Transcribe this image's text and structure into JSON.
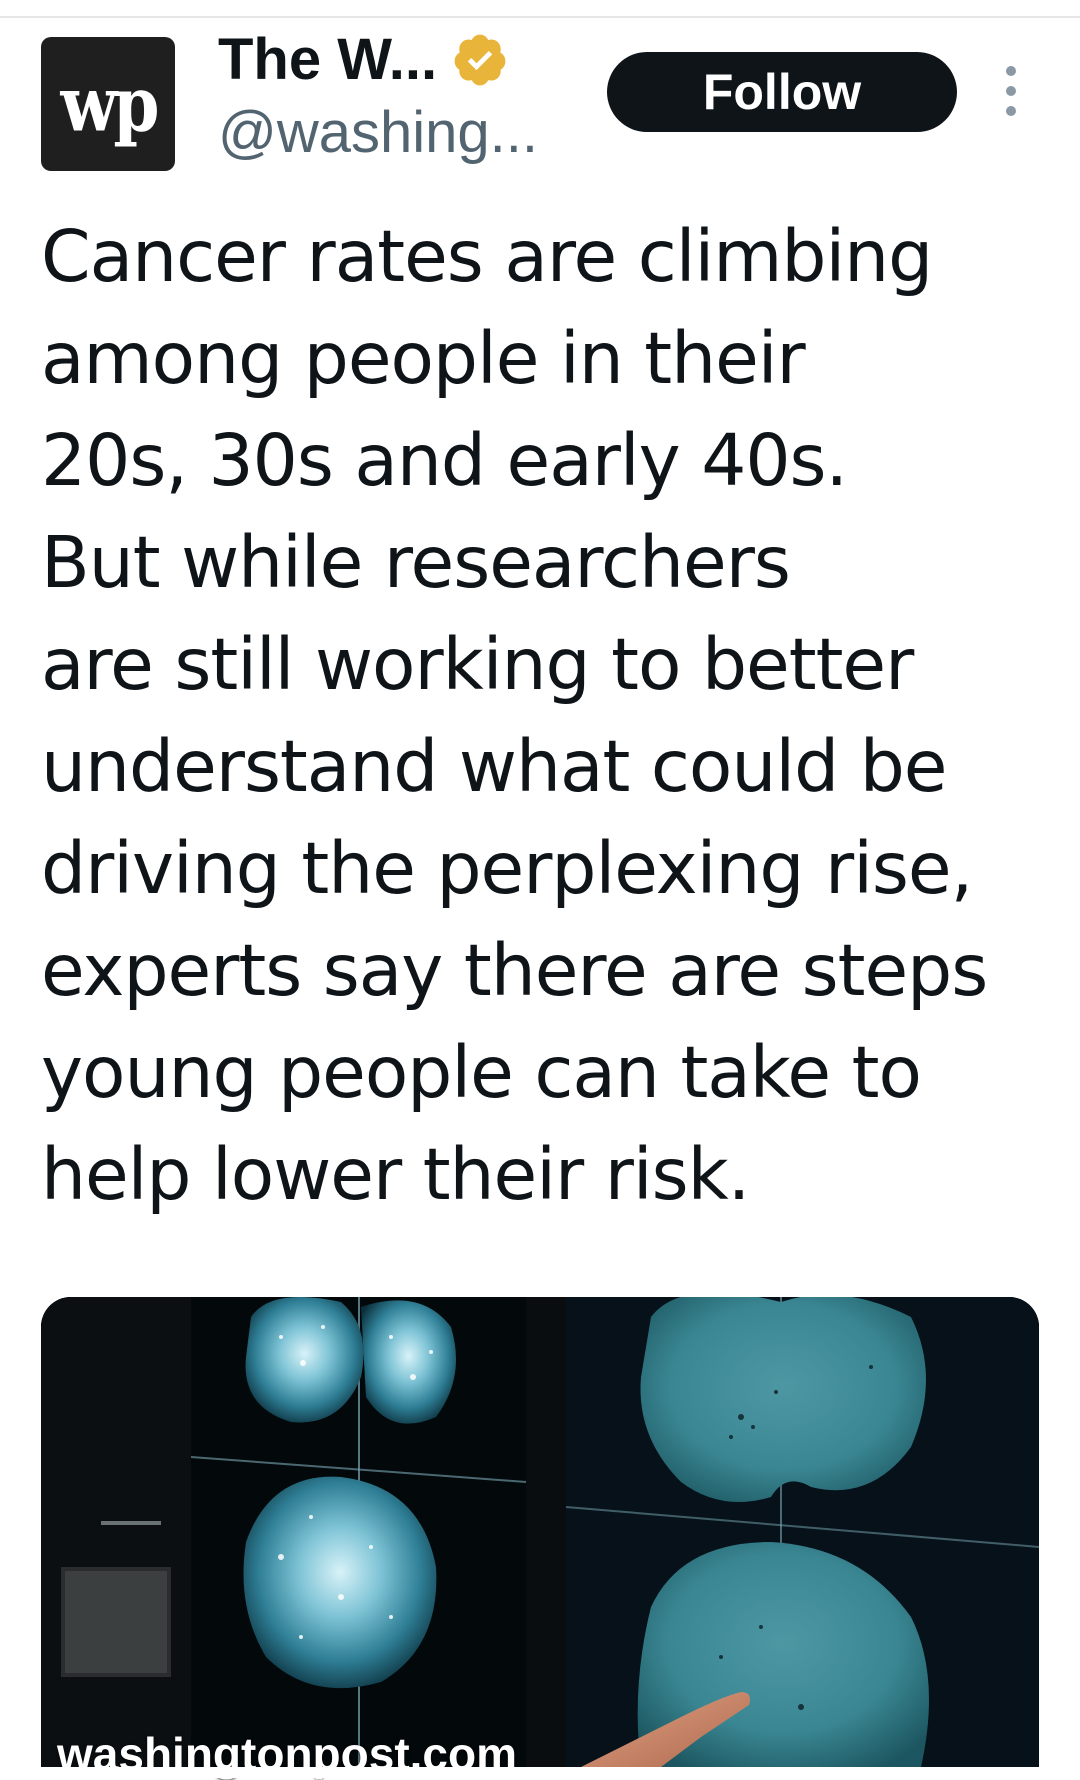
{
  "tweet": {
    "author": {
      "display_name": "The W...",
      "handle": "@washing...",
      "avatar_text": "wp",
      "verified_color": "#e8b43a"
    },
    "follow_label": "Follow",
    "text_lines": [
      "Cancer rates are climbing",
      "among people in their",
      "20s, 30s and early 40s.",
      "But while researchers",
      "are still working to better",
      "understand what could be",
      "driving the perplexing rise,",
      "experts say there are steps",
      "young people can take to",
      "help lower their risk."
    ],
    "link_card": {
      "domain": "washingtonpost.com"
    }
  },
  "icons": {
    "verified": "verified-badge-icon",
    "more": "more-options-icon"
  },
  "colors": {
    "text": "#0f1419",
    "secondary_text": "#536471",
    "button_bg": "#0f1419",
    "button_text": "#ffffff",
    "verified_gold": "#e8b43a"
  }
}
